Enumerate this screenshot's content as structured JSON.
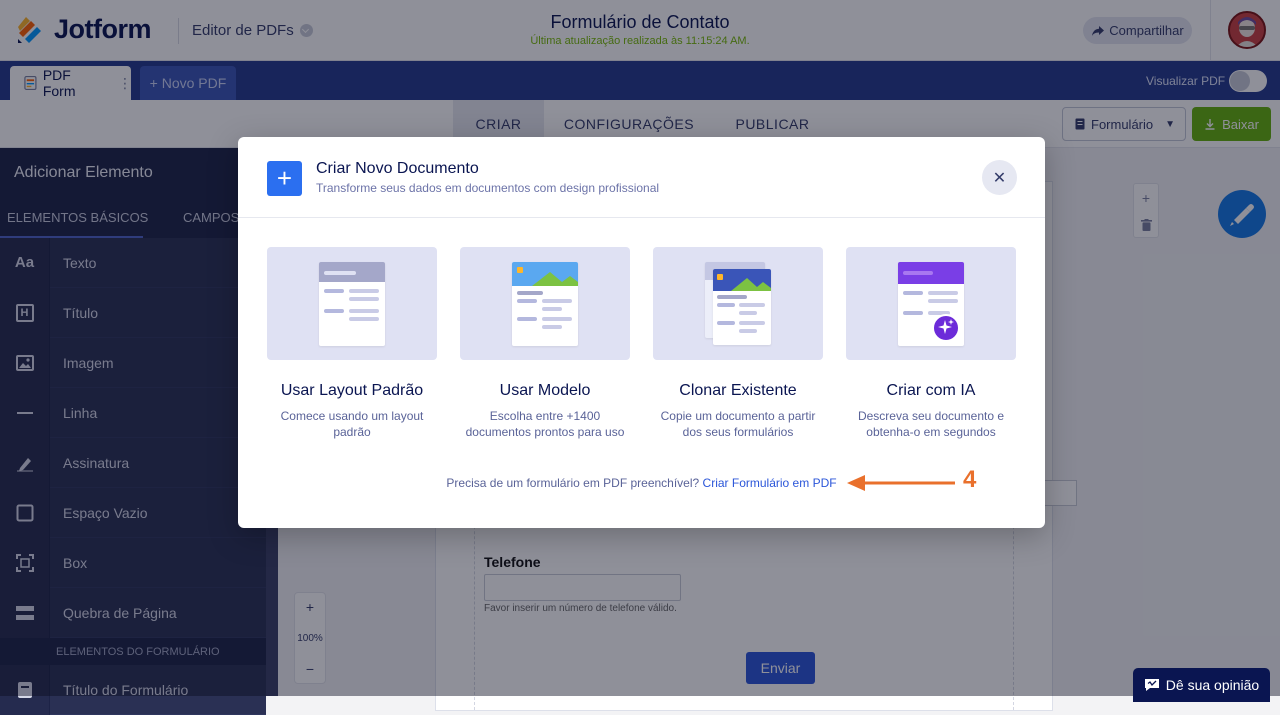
{
  "app": {
    "brand": "Jotform",
    "editor_label": "Editor de PDFs",
    "doc_title": "Formulário de Contato",
    "doc_subtitle": "Última atualização realizada às 11:15:24 AM.",
    "share_label": "Compartilhar"
  },
  "tabs": {
    "pdf_form": "PDF Form",
    "new_pdf": "+ Novo PDF",
    "preview_label": "Visualizar PDF"
  },
  "nav": {
    "tabs": [
      "CRIAR",
      "CONFIGURAÇÕES",
      "PUBLICAR"
    ],
    "form_select": "Formulário",
    "download": "Baixar"
  },
  "sidebar": {
    "title": "Adicionar Elemento",
    "tab_basic": "ELEMENTOS BÁSICOS",
    "tab_fields": "CAMPOS",
    "items": [
      {
        "icon": "Aa",
        "label": "Texto"
      },
      {
        "icon": "H",
        "label": "Título"
      },
      {
        "icon": "image-icon",
        "label": "Imagem"
      },
      {
        "icon": "line-icon",
        "label": "Linha"
      },
      {
        "icon": "signature-icon",
        "label": "Assinatura"
      },
      {
        "icon": "square-icon",
        "label": "Espaço Vazio"
      },
      {
        "icon": "box-icon",
        "label": "Box"
      },
      {
        "icon": "page-break-icon",
        "label": "Quebra de Página"
      }
    ],
    "section_form": "ELEMENTOS DO FORMULÁRIO",
    "form_items": [
      {
        "icon": "form-title-icon",
        "label": "Título do Formulário"
      }
    ]
  },
  "canvas": {
    "phone_label": "Telefone",
    "phone_help": "Favor inserir um número de telefone válido.",
    "send_label": "Enviar",
    "zoom_level": "100%",
    "zoom_in": "+",
    "zoom_out": "−",
    "feedback_label": "Dê sua opinião"
  },
  "modal": {
    "title": "Criar Novo Documento",
    "subtitle": "Transforme seus dados em documentos com design profissional",
    "options": [
      {
        "title": "Usar Layout Padrão",
        "desc": "Comece usando um layout padrão"
      },
      {
        "title": "Usar Modelo",
        "desc": "Escolha entre +1400 documentos prontos para uso"
      },
      {
        "title": "Clonar Existente",
        "desc": "Copie um documento a partir dos seus formulários"
      },
      {
        "title": "Criar com IA",
        "desc": "Descreva seu documento e obtenha-o em segundos"
      }
    ],
    "footer_text": "Precisa de um formulário em PDF preenchível?",
    "footer_link": "Criar Formulário em PDF"
  },
  "annotation": {
    "number": "4",
    "color": "#e9702c"
  },
  "colors": {
    "brand_blue": "#243a8c",
    "accent": "#2b6ff0",
    "download_green": "#64b20a",
    "update_green": "#78bb07"
  }
}
